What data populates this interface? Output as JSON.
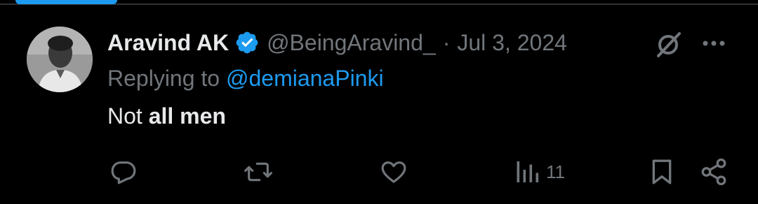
{
  "tweet": {
    "author_name": "Aravind AK",
    "handle": "@BeingAravind_",
    "separator": "·",
    "timestamp": "Jul 3, 2024",
    "reply_prefix": "Replying to",
    "reply_to_handle": "@demianaPinki",
    "text_plain": "Not",
    "text_bold": "all men",
    "views_count": "11"
  },
  "icons": {
    "verified": "verified-badge-icon",
    "grok": "grok-icon",
    "more": "more-options-icon",
    "reply": "reply-icon",
    "retweet": "retweet-icon",
    "like": "like-icon",
    "views": "views-icon",
    "bookmark": "bookmark-icon",
    "share": "share-icon"
  },
  "colors": {
    "background": "#000000",
    "text_primary": "#e7e9ea",
    "text_secondary": "#71767b",
    "accent": "#1d9bf0",
    "divider": "#2f3336"
  }
}
